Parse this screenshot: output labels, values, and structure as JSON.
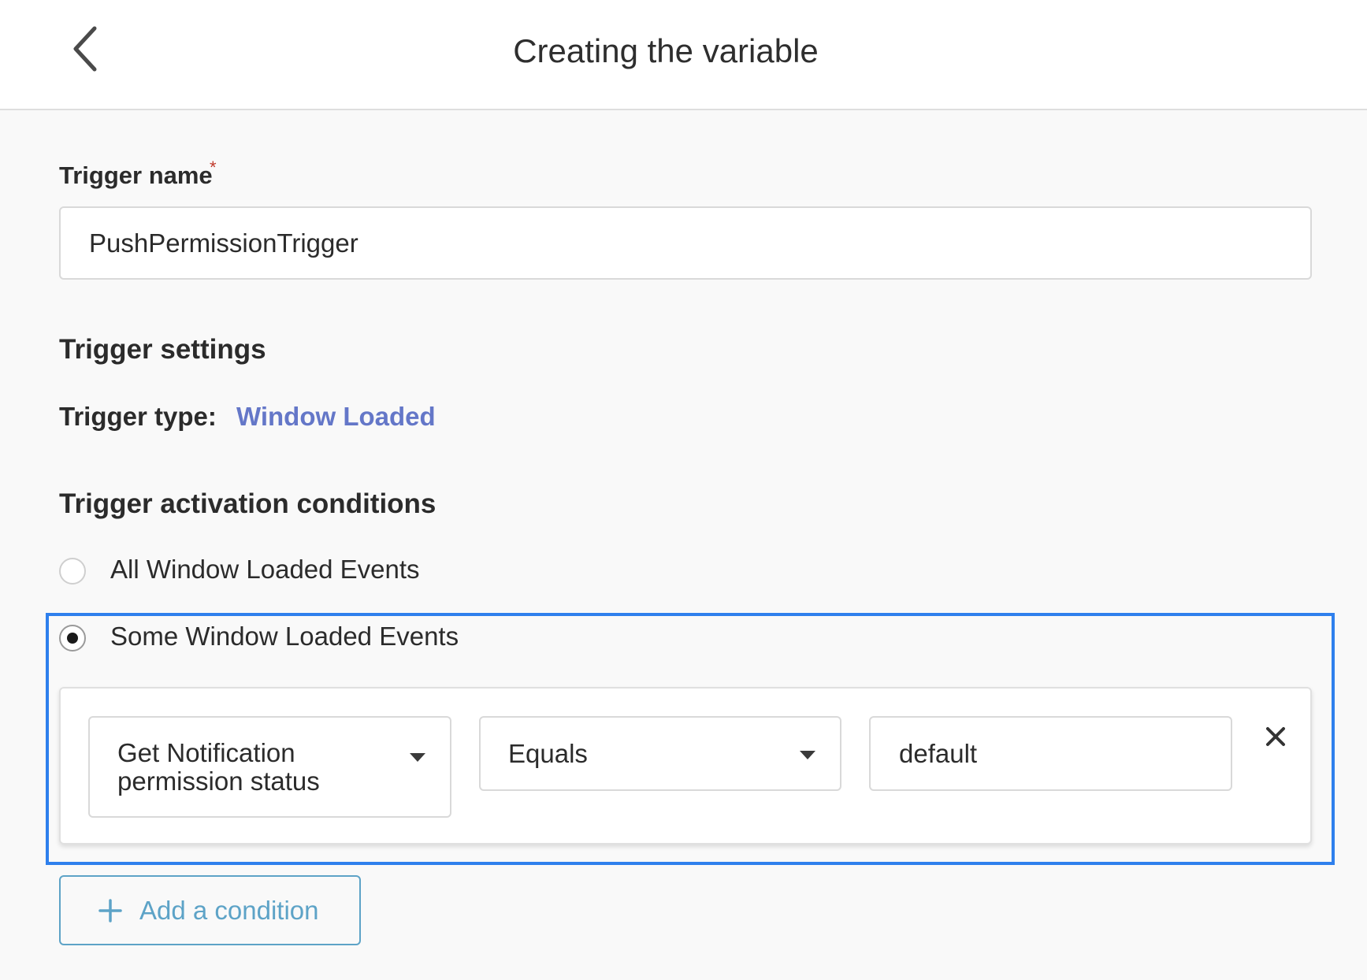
{
  "header": {
    "title": "Creating the variable",
    "back_icon": "chevron-left-icon"
  },
  "trigger_name": {
    "label": "Trigger name",
    "required_mark": "*",
    "value": "PushPermissionTrigger"
  },
  "settings": {
    "heading": "Trigger settings",
    "type_label": "Trigger type:",
    "type_value": "Window Loaded"
  },
  "conditions": {
    "heading": "Trigger activation conditions",
    "options": [
      {
        "label": "All Window Loaded Events",
        "selected": false
      },
      {
        "label": "Some Window Loaded Events",
        "selected": true
      }
    ],
    "rule": {
      "variable_line1": "Get Notification",
      "variable_line2": "permission status",
      "operator": "Equals",
      "value": "default"
    },
    "add_label": "Add a condition"
  },
  "colors": {
    "accent_link": "#6477c8",
    "highlight_border": "#2f80ed",
    "add_button": "#5da3c7",
    "required": "#c0392b"
  }
}
